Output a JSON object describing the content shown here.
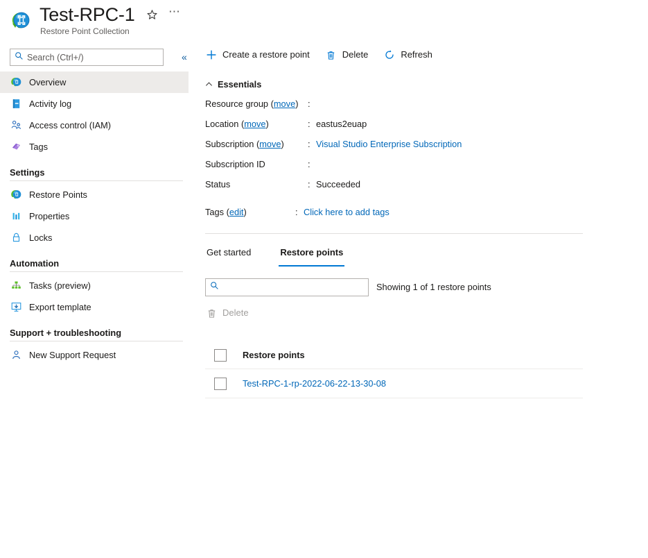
{
  "header": {
    "title": "Test-RPC-1",
    "subtitle": "Restore Point Collection",
    "resource_icon": "restore-point-collection-icon",
    "favorite_icon": "star-icon",
    "more_icon": "ellipsis-icon"
  },
  "sidebar": {
    "search_placeholder": "Search (Ctrl+/)",
    "search_value": "",
    "collapse_label": "«",
    "items": [
      {
        "label": "Overview",
        "icon": "overview-globe-icon",
        "active": true
      },
      {
        "label": "Activity log",
        "icon": "activity-log-icon",
        "active": false
      },
      {
        "label": "Access control (IAM)",
        "icon": "access-control-people-icon",
        "active": false
      },
      {
        "label": "Tags",
        "icon": "tag-icon",
        "active": false
      }
    ],
    "groups": [
      {
        "title": "Settings",
        "items": [
          {
            "label": "Restore Points",
            "icon": "restore-points-globe-icon"
          },
          {
            "label": "Properties",
            "icon": "properties-bars-icon"
          },
          {
            "label": "Locks",
            "icon": "lock-icon"
          }
        ]
      },
      {
        "title": "Automation",
        "items": [
          {
            "label": "Tasks (preview)",
            "icon": "tasks-hierarchy-icon"
          },
          {
            "label": "Export template",
            "icon": "export-template-icon"
          }
        ]
      },
      {
        "title": "Support + troubleshooting",
        "items": [
          {
            "label": "New Support Request",
            "icon": "support-person-icon"
          }
        ]
      }
    ]
  },
  "command_bar": {
    "buttons": [
      {
        "label": "Create a restore point",
        "icon": "plus-icon"
      },
      {
        "label": "Delete",
        "icon": "trash-icon"
      },
      {
        "label": "Refresh",
        "icon": "refresh-icon"
      }
    ]
  },
  "essentials": {
    "section_title": "Essentials",
    "collapse_icon": "chevron-up-icon",
    "rows": [
      {
        "key": "Resource group",
        "action": "move",
        "colon": ":",
        "value": "",
        "value_type": "text"
      },
      {
        "key": "Location",
        "action": "move",
        "colon": ":",
        "value": "eastus2euap",
        "value_type": "text"
      },
      {
        "key": "Subscription",
        "action": "move",
        "colon": ":",
        "value": "Visual Studio Enterprise Subscription",
        "value_type": "link"
      },
      {
        "key": "Subscription ID",
        "action": "",
        "colon": ":",
        "value": "",
        "value_type": "text"
      },
      {
        "key": "Status",
        "action": "",
        "colon": ":",
        "value": "Succeeded",
        "value_type": "text"
      }
    ],
    "tags_row": {
      "key": "Tags",
      "action": "edit",
      "colon": ":",
      "value": "Click here to add tags"
    }
  },
  "tabs": [
    {
      "label": "Get started",
      "selected": false
    },
    {
      "label": "Restore points",
      "selected": true
    }
  ],
  "filter": {
    "search_placeholder": "",
    "search_value": "",
    "search_icon": "search-icon",
    "showing_text": "Showing 1 of 1 restore points"
  },
  "table_toolbar": {
    "delete_label": "Delete",
    "delete_icon": "trash-icon",
    "delete_disabled": true
  },
  "table": {
    "header": {
      "select_all_icon": "checkbox-icon",
      "column": "Restore points"
    },
    "rows": [
      {
        "checkbox_icon": "checkbox-icon",
        "name": "Test-RPC-1-rp-2022-06-22-13-30-08"
      }
    ]
  },
  "colors": {
    "accent": "#0078d4",
    "link": "#0067b8",
    "text": "#1b1a19",
    "muted": "#605e5c",
    "selected_row_bg": "#edebe9",
    "divider": "#e1dfdd"
  }
}
